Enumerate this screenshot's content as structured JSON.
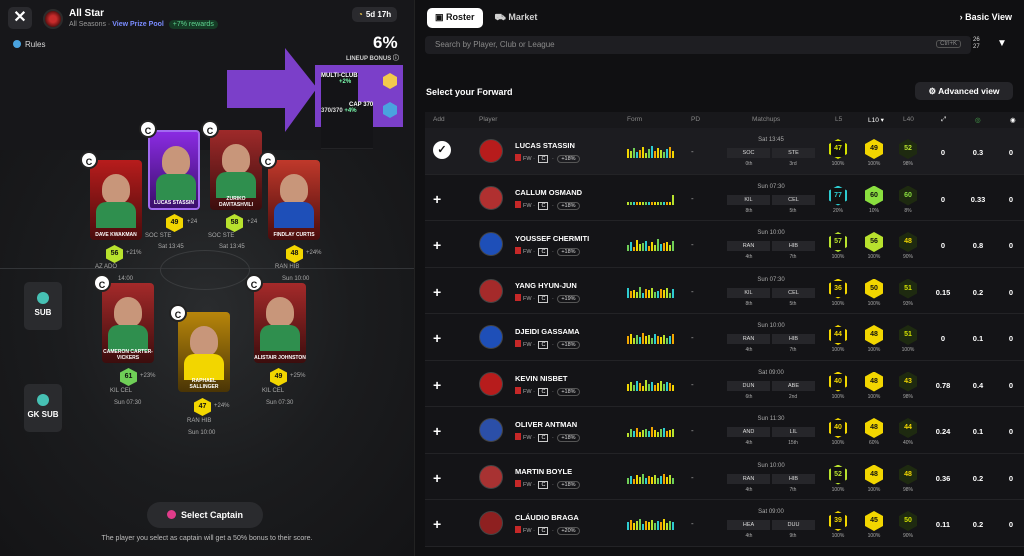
{
  "header": {
    "close_label": "✕",
    "title": "All Star",
    "subtitle_prefix": "All Seasons ·",
    "prize_pool": "View Prize Pool",
    "rewards": "+7% rewards",
    "timer": "5d 17h",
    "rules": "Rules"
  },
  "lineup_bonus": {
    "value": "6%",
    "label": "LINEUP BONUS",
    "multi_club": "MULTI-CLUB",
    "multi_club_gain": "+2%",
    "cap": "CAP 370",
    "cap_value": "370/370",
    "cap_gain": "+4%"
  },
  "pitch": {
    "cards": [
      {
        "name": "DAVE KWAKMAN",
        "color": "#b71c1c"
      },
      {
        "name": "LUCAS STASSIN",
        "color": "#8a2be2"
      },
      {
        "name": "ZURIKO DAVITASHVILI",
        "color": "#9e2a2a"
      },
      {
        "name": "FINDLAY CURTIS",
        "color": "#c0392b"
      },
      {
        "name": "CAMERON CARTER-VICKERS",
        "color": "#a52a2a"
      },
      {
        "name": "RAPHAEL SALLINGER",
        "color": "#b8860b"
      },
      {
        "name": "ALISTAIR JOHNSTON",
        "color": "#a52a2a"
      }
    ],
    "scores": [
      {
        "v": "49",
        "b": "+24",
        "c": "#f2d600"
      },
      {
        "v": "58",
        "b": "+24",
        "c": "#b8e22e"
      },
      {
        "v": "56",
        "b": "+21%",
        "c": "#b8e22e"
      },
      {
        "v": "48",
        "b": "+24%",
        "c": "#f2d600"
      },
      {
        "v": "61",
        "b": "+23%",
        "c": "#6fcf57"
      },
      {
        "v": "49",
        "b": "+25%",
        "c": "#f2d600"
      },
      {
        "v": "47",
        "b": "+24%",
        "c": "#f2d600"
      }
    ],
    "fixtures": [
      "Sat 13:45",
      "Sat 13:45",
      "Sun 10:00",
      "Sun 07:30",
      "Sun 07:30",
      "Sun 10:00"
    ],
    "teams": [
      "SOC",
      "STE",
      "SOC",
      "STE",
      "AZ",
      "ADO",
      "RAN",
      "HIB",
      "KIL",
      "CEL",
      "KIL",
      "CEL",
      "RAN",
      "HIB"
    ],
    "extra_time": "14:00",
    "sub_label": "SUB",
    "gk_sub_label": "GK SUB",
    "captain_badge": "C"
  },
  "captain": {
    "button": "Select Captain",
    "note": "The player you select as captain will get a 50% bonus to their score."
  },
  "right": {
    "tabs": [
      "Roster",
      "Market"
    ],
    "basic_view": "Basic View",
    "search_placeholder": "Search by Player, Club or League",
    "search_kbd": "Ctrl+K",
    "filter_count_top": "26",
    "filter_count_bottom": "27",
    "section_title": "Select your Forward",
    "advanced_view": "Advanced view",
    "columns": [
      "Add",
      "Player",
      "Form",
      "PD",
      "Matchups",
      "L5",
      "L10 ▾",
      "L40"
    ],
    "position": "FW",
    "card_mark": "C"
  },
  "rows": [
    {
      "name": "LUCAS STASSIN",
      "pct": "+18%",
      "time": "Sat 13:45",
      "home": "SOC",
      "away": "STE",
      "hr": "0th",
      "ar": "3rd",
      "l5": "47",
      "l5p": "100%",
      "l10": "49",
      "l10p": "100%",
      "l40": "52",
      "l40p": "98%",
      "s1": "0",
      "s2": "0.3",
      "s3": "0",
      "selected": true,
      "avatar": "#b71c1c",
      "c5": "#d4e200",
      "c10": "#f2d600",
      "c40": "#b8e22e"
    },
    {
      "name": "CALLUM OSMAND",
      "pct": "+18%",
      "time": "Sun 07:30",
      "home": "KIL",
      "away": "CEL",
      "hr": "8th",
      "ar": "5th",
      "l5": "77",
      "l5p": "20%",
      "l10": "60",
      "l10p": "10%",
      "l40": "60",
      "l40p": "8%",
      "s1": "0",
      "s2": "0.33",
      "s3": "0",
      "selected": false,
      "avatar": "#b03030",
      "c5": "#2ecbd0",
      "c10": "#8adf3f",
      "c40": "#8adf3f"
    },
    {
      "name": "YOUSSEF CHERMITI",
      "pct": "+18%",
      "time": "Sun 10:00",
      "home": "RAN",
      "away": "HIB",
      "hr": "4th",
      "ar": "7th",
      "l5": "57",
      "l5p": "100%",
      "l10": "56",
      "l10p": "100%",
      "l40": "48",
      "l40p": "90%",
      "s1": "0",
      "s2": "0.8",
      "s3": "0",
      "selected": false,
      "avatar": "#1e4fb8",
      "c5": "#b8e22e",
      "c10": "#b8e22e",
      "c40": "#f2d600"
    },
    {
      "name": "YANG HYUN-JUN",
      "pct": "+19%",
      "time": "Sun 07:30",
      "home": "KIL",
      "away": "CEL",
      "hr": "8th",
      "ar": "5th",
      "l5": "36",
      "l5p": "100%",
      "l10": "50",
      "l10p": "100%",
      "l40": "51",
      "l40p": "93%",
      "s1": "0.15",
      "s2": "0.2",
      "s3": "0",
      "selected": false,
      "avatar": "#a52a2a",
      "c5": "#f2d600",
      "c10": "#f2d600",
      "c40": "#d4e200"
    },
    {
      "name": "DJEIDI GASSAMA",
      "pct": "+18%",
      "time": "Sun 10:00",
      "home": "RAN",
      "away": "HIB",
      "hr": "4th",
      "ar": "7th",
      "l5": "44",
      "l5p": "100%",
      "l10": "48",
      "l10p": "100%",
      "l40": "51",
      "l40p": "100%",
      "s1": "0",
      "s2": "0.1",
      "s3": "0",
      "selected": false,
      "avatar": "#1e4fb8",
      "c5": "#f2d600",
      "c10": "#f2d600",
      "c40": "#d4e200"
    },
    {
      "name": "KEVIN NISBET",
      "pct": "+18%",
      "time": "Sat 09:00",
      "home": "DUN",
      "away": "ABE",
      "hr": "6th",
      "ar": "2nd",
      "l5": "40",
      "l5p": "100%",
      "l10": "48",
      "l10p": "100%",
      "l40": "43",
      "l40p": "98%",
      "s1": "0.78",
      "s2": "0.4",
      "s3": "0",
      "selected": false,
      "avatar": "#b71c1c",
      "c5": "#f2d600",
      "c10": "#f2d600",
      "c40": "#f2d600"
    },
    {
      "name": "OLIVER ANTMAN",
      "pct": "+18%",
      "time": "Sun 11:30",
      "home": "AND",
      "away": "LIL",
      "hr": "4th",
      "ar": "15th",
      "l5": "40",
      "l5p": "100%",
      "l10": "48",
      "l10p": "60%",
      "l40": "44",
      "l40p": "40%",
      "s1": "0.24",
      "s2": "0.1",
      "s3": "0",
      "selected": false,
      "avatar": "#2b4fa8",
      "c5": "#f2d600",
      "c10": "#f2d600",
      "c40": "#f2d600"
    },
    {
      "name": "MARTIN BOYLE",
      "pct": "+18%",
      "time": "Sun 10:00",
      "home": "RAN",
      "away": "HIB",
      "hr": "4th",
      "ar": "7th",
      "l5": "52",
      "l5p": "100%",
      "l10": "48",
      "l10p": "100%",
      "l40": "48",
      "l40p": "98%",
      "s1": "0.36",
      "s2": "0.2",
      "s3": "0",
      "selected": false,
      "avatar": "#a83232",
      "c5": "#b8e22e",
      "c10": "#f2d600",
      "c40": "#f2d600"
    },
    {
      "name": "CLÁUDIO BRAGA",
      "pct": "+20%",
      "time": "Sat 09:00",
      "home": "HEA",
      "away": "DUU",
      "hr": "4th",
      "ar": "9th",
      "l5": "39",
      "l5p": "100%",
      "l10": "45",
      "l10p": "100%",
      "l40": "50",
      "l40p": "90%",
      "s1": "0.11",
      "s2": "0.2",
      "s3": "0",
      "selected": false,
      "avatar": "#8e2020",
      "c5": "#f2d600",
      "c10": "#f2d600",
      "c40": "#d4e200"
    }
  ]
}
